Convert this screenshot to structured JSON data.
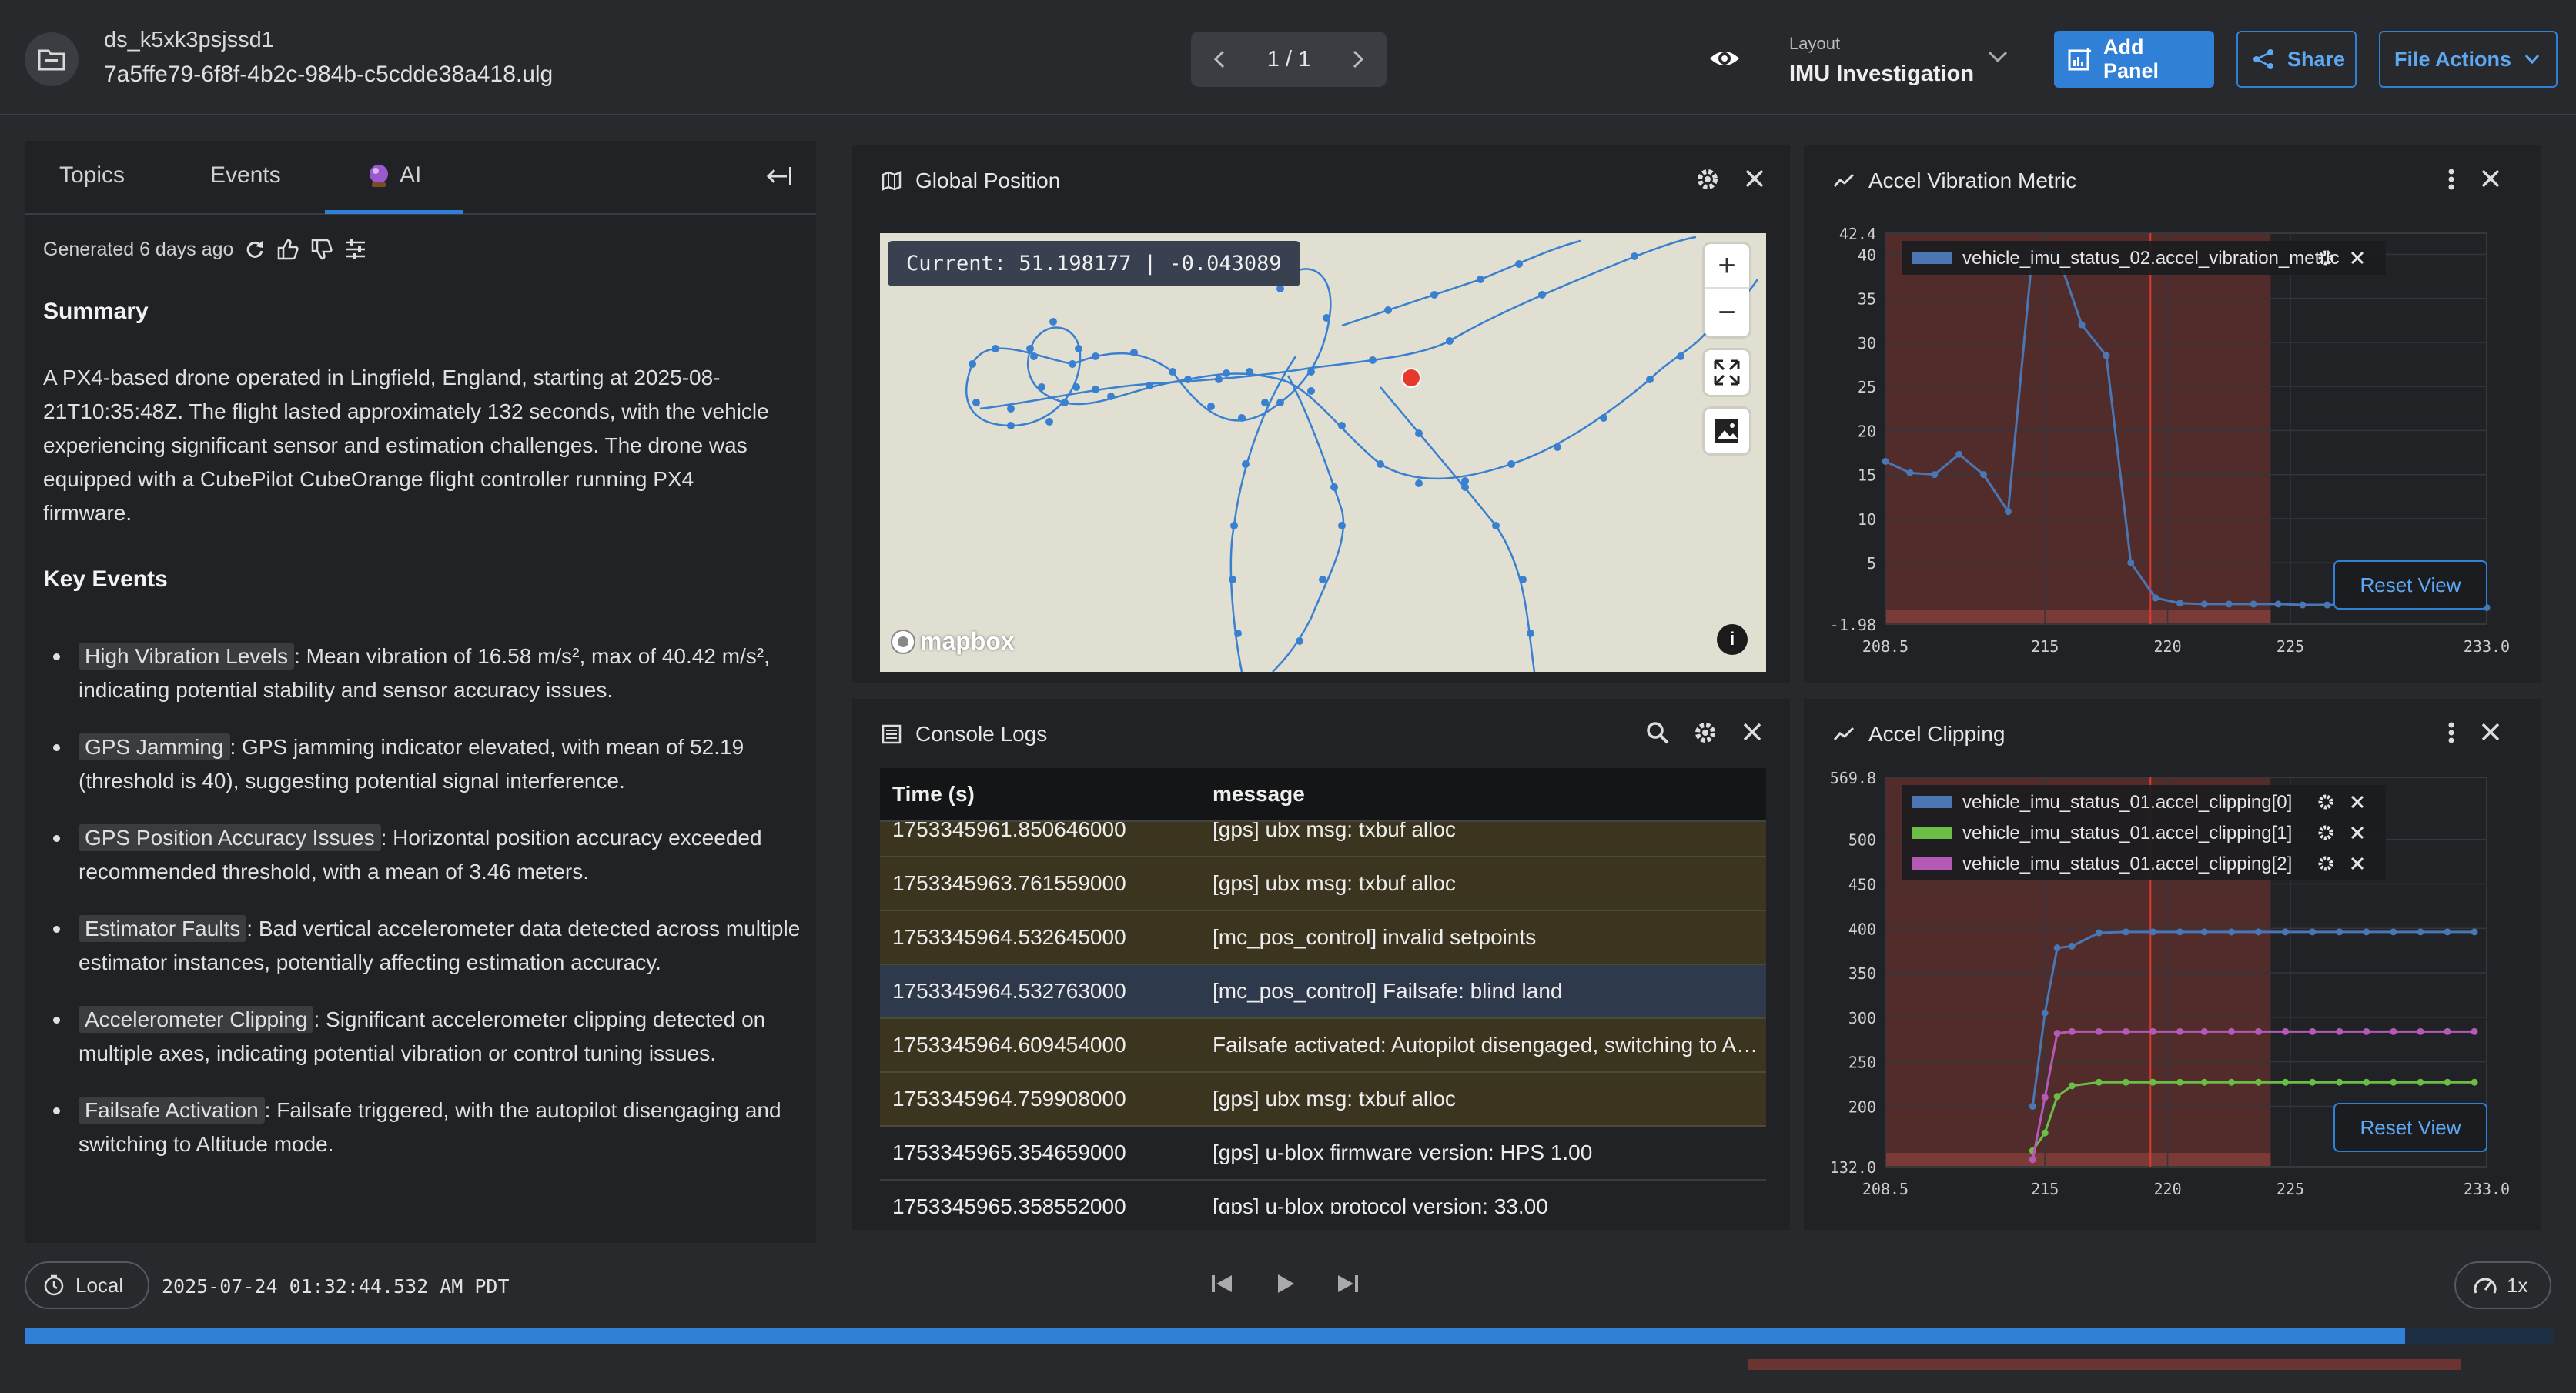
{
  "header": {
    "dataset": "ds_k5xk3psjssd1",
    "file": "7a5ffe79-6f8f-4b2c-984b-c5cdde38a418.ulg",
    "pager": "1 / 1",
    "layout_label": "Layout",
    "layout_name": "IMU Investigation",
    "add_panel": "Add Panel",
    "share": "Share",
    "file_actions": "File Actions"
  },
  "sidebar": {
    "tabs": [
      {
        "label": "Topics"
      },
      {
        "label": "Events"
      },
      {
        "label": "AI"
      }
    ],
    "active_tab": "AI",
    "generated": "Generated 6 days ago",
    "summary_heading": "Summary",
    "summary": "A PX4-based drone operated in Lingfield, England, starting at 2025-08-21T10:35:48Z. The flight lasted approximately 132 seconds, with the vehicle experiencing significant sensor and estimation challenges. The drone was equipped with a CubePilot CubeOrange flight controller running PX4 firmware.",
    "key_events_heading": "Key Events",
    "events": [
      {
        "label": "High Vibration Levels",
        "text": ": Mean vibration of 16.58 m/s², max of 40.42 m/s², indicating potential stability and sensor accuracy issues."
      },
      {
        "label": "GPS Jamming",
        "text": ": GPS jamming indicator elevated, with mean of 52.19 (threshold is 40), suggesting potential signal interference."
      },
      {
        "label": "GPS Position Accuracy Issues",
        "text": ": Horizontal position accuracy exceeded recommended threshold, with a mean of 3.46 meters."
      },
      {
        "label": "Estimator Faults",
        "text": ": Bad vertical accelerometer data detected across multiple estimator instances, potentially affecting estimation accuracy."
      },
      {
        "label": "Accelerometer Clipping",
        "text": ": Significant accelerometer clipping detected on multiple axes, indicating potential vibration or control tuning issues."
      },
      {
        "label": "Failsafe Activation",
        "text": ": Failsafe triggered, with the autopilot disengaging and switching to Altitude mode."
      }
    ]
  },
  "global_position": {
    "title": "Global Position",
    "current": "Current: 51.198177 | -0.043089",
    "attribution": "mapbox",
    "zoom_in": "+",
    "zoom_out": "−"
  },
  "console": {
    "title": "Console Logs",
    "col_time": "Time (s)",
    "col_message": "message",
    "rows": [
      {
        "time": "1753345961.850646000",
        "message": "[gps] ubx msg: txbuf alloc",
        "level": "warn"
      },
      {
        "time": "1753345963.761559000",
        "message": "[gps] ubx msg: txbuf alloc",
        "level": "warn"
      },
      {
        "time": "1753345964.532645000",
        "message": "[mc_pos_control] invalid setpoints",
        "level": "warn"
      },
      {
        "time": "1753345964.532763000",
        "message": "[mc_pos_control] Failsafe: blind land",
        "level": "selected"
      },
      {
        "time": "1753345964.609454000",
        "message": "Failsafe activated: Autopilot disengaged, switching to Altitude mode",
        "level": "warn"
      },
      {
        "time": "1753345964.759908000",
        "message": "[gps] ubx msg: txbuf alloc",
        "level": "warn"
      },
      {
        "time": "1753345965.354659000",
        "message": "[gps] u-blox firmware version: HPS 1.00",
        "level": "info"
      },
      {
        "time": "1753345965.358552000",
        "message": "[gps] u-blox protocol version: 33.00",
        "level": "info"
      }
    ]
  },
  "chart_data": [
    {
      "type": "line",
      "title": "Accel Vibration Metric",
      "xlim": [
        208.5,
        233.0
      ],
      "ylim": [
        -1.98,
        42.4
      ],
      "x_ticks": [
        "208.5",
        "215",
        "220",
        "225",
        "233.0"
      ],
      "y_ticks": [
        "42.4",
        "40",
        "35",
        "30",
        "25",
        "20",
        "15",
        "10",
        "5",
        "-1.98"
      ],
      "series": [
        {
          "name": "vehicle_imu_status_02.accel_vibration_metric",
          "color": "#4a76b4",
          "x": [
            208.5,
            209.5,
            210.5,
            211.5,
            212.5,
            213.5,
            214.5,
            215.5,
            216.5,
            217.5,
            218.5,
            219.5,
            220.5,
            221.5,
            222.5,
            223.5,
            224.5,
            225.5,
            226.5,
            227.5,
            228.5,
            229.5,
            230.5,
            231.5,
            232.5,
            233.0
          ],
          "y": [
            16.5,
            15.2,
            15.0,
            17.3,
            15.0,
            10.8,
            40.4,
            40.1,
            32.0,
            28.5,
            5.0,
            1.0,
            0.4,
            0.3,
            0.3,
            0.3,
            0.3,
            0.2,
            0.2,
            0.2,
            0.2,
            0.2,
            0.1,
            0.0,
            0.0,
            -0.1
          ]
        }
      ],
      "failsafe_region": [
        208.5,
        224.2
      ],
      "cursor_x": 219.3,
      "grid": true,
      "legend": "top-left",
      "reset_label": "Reset View"
    },
    {
      "type": "line",
      "title": "Accel Clipping",
      "xlim": [
        208.5,
        233.0
      ],
      "ylim": [
        132.0,
        569.8
      ],
      "x_ticks": [
        "208.5",
        "215",
        "220",
        "225",
        "233.0"
      ],
      "y_ticks": [
        "569.8",
        "500",
        "450",
        "400",
        "350",
        "300",
        "250",
        "200",
        "132.0"
      ],
      "series": [
        {
          "name": "vehicle_imu_status_01.accel_clipping[0]",
          "color": "#4a76b4",
          "x": [
            214.5,
            215.0,
            215.5,
            216.1,
            217.2,
            218.3,
            219.4,
            220.5,
            221.5,
            222.6,
            223.7,
            224.8,
            225.9,
            227.0,
            228.1,
            229.2,
            230.3,
            231.4,
            232.5
          ],
          "y": [
            200,
            305,
            378,
            380,
            395,
            396,
            396,
            396,
            396,
            396,
            396,
            396,
            396,
            396,
            396,
            396,
            396,
            396,
            396
          ]
        },
        {
          "name": "vehicle_imu_status_01.accel_clipping[1]",
          "color": "#6cbd45",
          "x": [
            214.5,
            215.0,
            215.5,
            216.1,
            217.2,
            218.3,
            219.4,
            220.5,
            221.5,
            222.6,
            223.7,
            224.8,
            225.9,
            227.0,
            228.1,
            229.2,
            230.3,
            231.4,
            232.5
          ],
          "y": [
            150,
            170,
            211,
            223,
            227,
            227,
            227,
            227,
            227,
            227,
            227,
            227,
            227,
            227,
            227,
            227,
            227,
            227,
            227
          ]
        },
        {
          "name": "vehicle_imu_status_01.accel_clipping[2]",
          "color": "#b45ab6",
          "x": [
            214.5,
            215.0,
            215.5,
            216.1,
            217.2,
            218.3,
            219.4,
            220.5,
            221.5,
            222.6,
            223.7,
            224.8,
            225.9,
            227.0,
            228.1,
            229.2,
            230.3,
            231.4,
            232.5
          ],
          "y": [
            140,
            210,
            282,
            284,
            284,
            284,
            284,
            284,
            284,
            284,
            284,
            284,
            284,
            284,
            284,
            284,
            284,
            284,
            284
          ]
        }
      ],
      "failsafe_region": [
        208.5,
        224.2
      ],
      "cursor_x": 219.3,
      "grid": true,
      "legend": "top-left",
      "reset_label": "Reset View"
    }
  ],
  "playback": {
    "timezone": "Local",
    "timestamp": "2025-07-24 01:32:44.532 AM PDT",
    "speed": "1x",
    "progress": 0.9415
  },
  "colors": {
    "accent": "#2f80d6",
    "failsafe": "#6b3332",
    "warn_row": "#3b3520",
    "marker": "#e8392d"
  }
}
